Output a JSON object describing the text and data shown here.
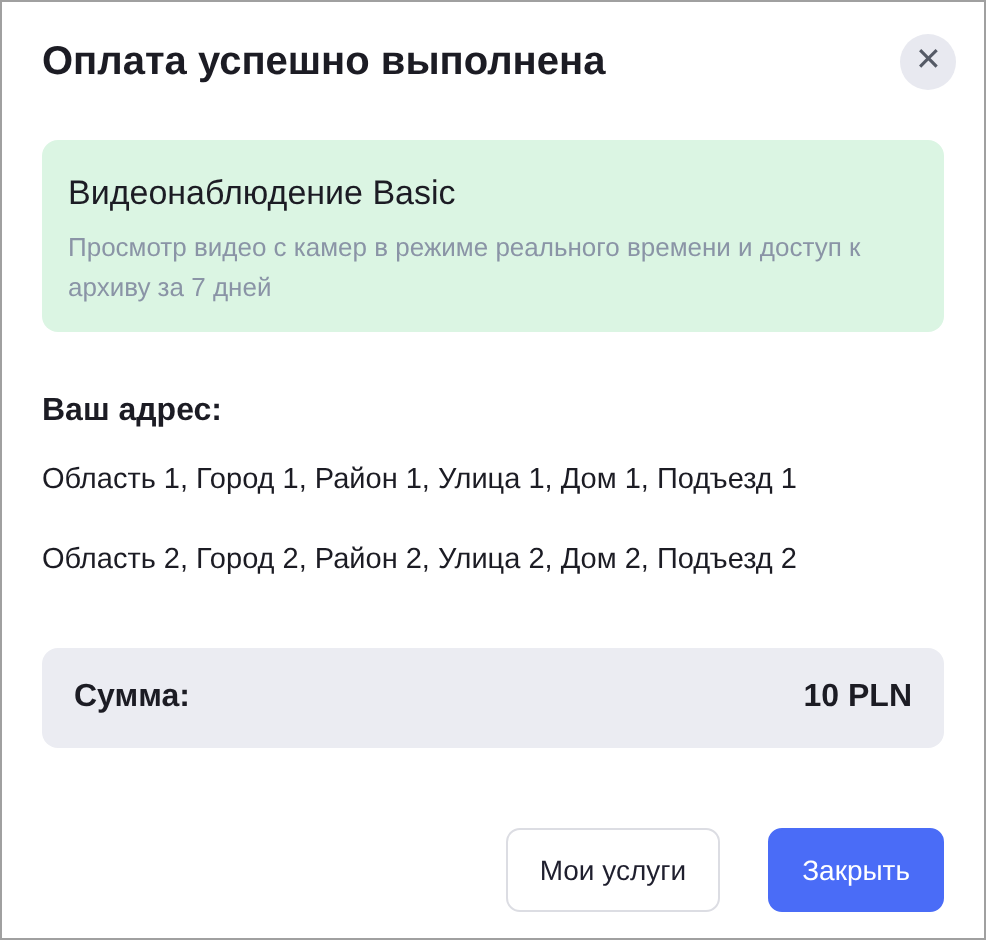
{
  "dialog": {
    "title": "Оплата успешно выполнена",
    "close_icon": "✕"
  },
  "service": {
    "name": "Видеонаблюдение Basic",
    "description": "Просмотр видео с камер в режиме реального времени и доступ к архиву за 7 дней"
  },
  "address": {
    "label": "Ваш адрес:",
    "lines": [
      "Область 1, Город 1, Район 1, Улица 1, Дом 1, Подъезд 1",
      "Область 2, Город 2, Район 2, Улица 2, Дом 2, Подъезд 2"
    ]
  },
  "total": {
    "label": "Сумма:",
    "value": "10 PLN"
  },
  "buttons": [
    {
      "label": "Мои услуги",
      "kind": "secondary"
    },
    {
      "label": "Закрыть",
      "kind": "primary"
    }
  ]
}
